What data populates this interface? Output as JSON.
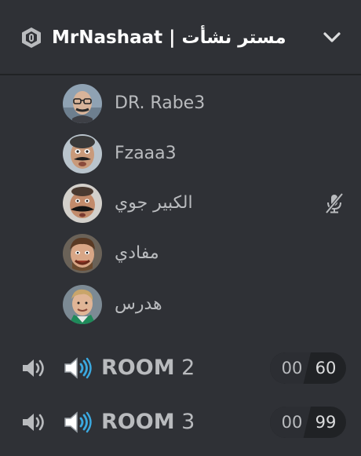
{
  "header": {
    "server_title": "MrNashaat | مستر نشأت",
    "badge_icon": "server-boost-badge-icon",
    "collapse_icon": "chevron-down-icon"
  },
  "members": [
    {
      "name": "DR. Rabe3",
      "avatar": "avatar",
      "muted": false
    },
    {
      "name": "Fzaaa3",
      "avatar": "avatar",
      "muted": false
    },
    {
      "name": "الكبير جوي",
      "avatar": "avatar",
      "muted": true
    },
    {
      "name": "مفادي",
      "avatar": "avatar",
      "muted": false
    },
    {
      "name": "هدرس",
      "avatar": "avatar",
      "muted": false
    }
  ],
  "rooms": [
    {
      "word": "ROOM",
      "number": "2",
      "users": "00",
      "limit": "60"
    },
    {
      "word": "ROOM",
      "number": "3",
      "users": "00",
      "limit": "99"
    }
  ],
  "colors": {
    "background": "#2f3136",
    "header_text": "#ffffff",
    "muted_text": "#b9bbbe",
    "voice_blue": "#3ba9e0",
    "gray_icon": "#b9bbbe"
  }
}
